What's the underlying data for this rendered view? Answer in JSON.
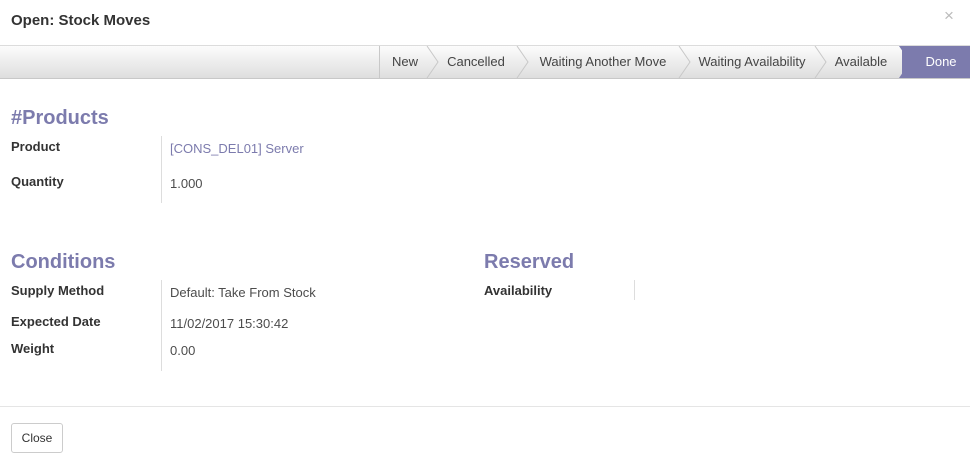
{
  "dialog": {
    "title": "Open: Stock Moves",
    "close_glyph": "×"
  },
  "statusbar": {
    "stages": [
      {
        "label": "New",
        "active": false
      },
      {
        "label": "Cancelled",
        "active": false
      },
      {
        "label": "Waiting Another Move",
        "active": false
      },
      {
        "label": "Waiting Availability",
        "active": false
      },
      {
        "label": "Available",
        "active": false
      },
      {
        "label": "Done",
        "active": true
      }
    ],
    "active_color": "#7c7bad"
  },
  "products": {
    "title": "#Products",
    "product_label": "Product",
    "product_value": "[CONS_DEL01] Server",
    "quantity_label": "Quantity",
    "quantity_value": "1.000"
  },
  "conditions": {
    "title": "Conditions",
    "supply_label": "Supply Method",
    "supply_value": "Default: Take From Stock",
    "date_label": "Expected Date",
    "date_value": "11/02/2017 15:30:42",
    "weight_label": "Weight",
    "weight_value": "0.00"
  },
  "reserved": {
    "title": "Reserved",
    "availability_label": "Availability",
    "availability_value": ""
  },
  "footer": {
    "close_label": "Close"
  }
}
